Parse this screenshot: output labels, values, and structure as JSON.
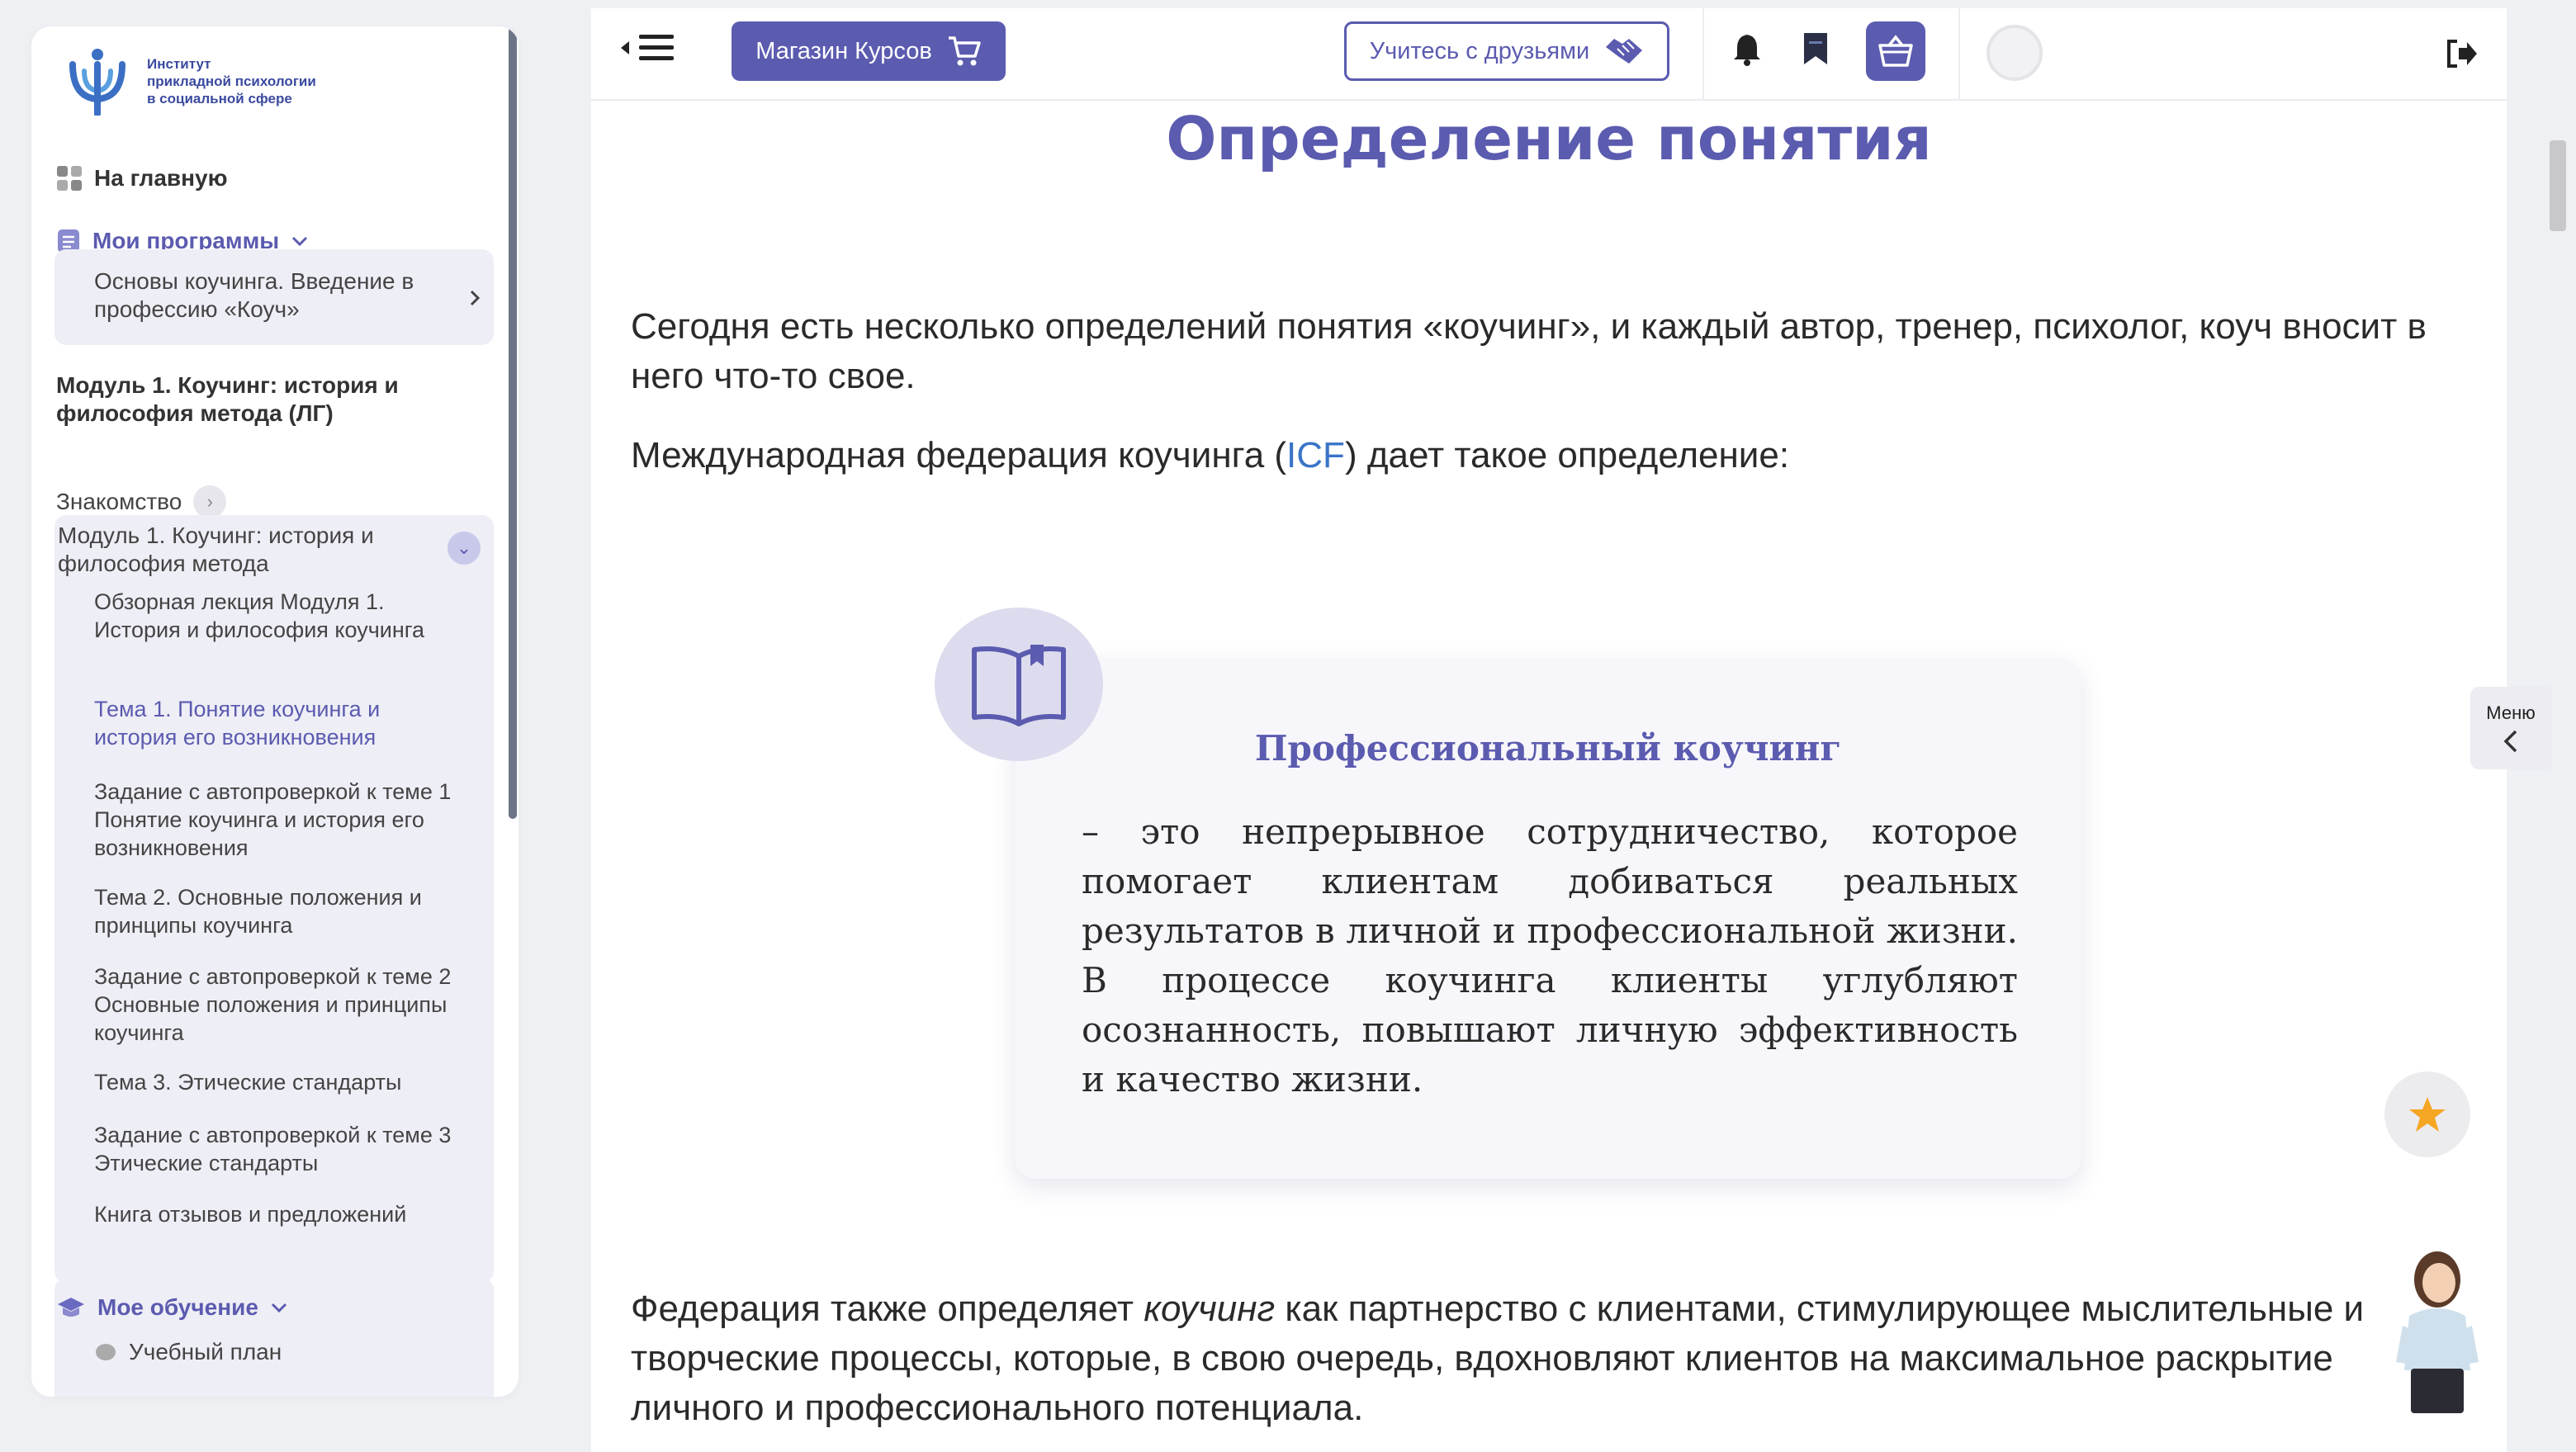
{
  "sidebar": {
    "logo": {
      "line1": "Институт",
      "line2": "прикладной психологии",
      "line3": "в социальной сфере"
    },
    "home_label": "На главную",
    "my_programs_label": "Мои программы",
    "program_title": "Основы коучинга. Введение в профессию «Коуч»",
    "module_heading": "Модуль 1. Коучинг: история и философия метода (ЛГ)",
    "intro_label": "Знакомство",
    "module_group_label": "Модуль 1. Коучинг: история и философия метода",
    "items": [
      {
        "label": "Обзорная лекция Модуля 1. История и философия коучинга",
        "active": false
      },
      {
        "label": "Тема 1. Понятие коучинга и история его возникновения",
        "active": true
      },
      {
        "label": "Задание с автопроверкой к теме 1 Понятие коучинга и история его возникновения",
        "active": false
      },
      {
        "label": "Тема 2. Основные положения и принципы коучинга",
        "active": false
      },
      {
        "label": "Задание с автопроверкой к теме 2 Основные положения и принципы коучинга",
        "active": false
      },
      {
        "label": "Тема 3. Этические стандарты",
        "active": false
      },
      {
        "label": "Задание с автопроверкой к теме 3 Этические стандарты",
        "active": false
      },
      {
        "label": "Книга отзывов и предложений",
        "active": false
      }
    ],
    "my_learning_label": "Мое обучение",
    "study_plan_label": "Учебный план"
  },
  "header": {
    "shop_label": "Магазин Курсов",
    "friends_label": "Учитесь с друзьями"
  },
  "main": {
    "title": "Определение понятия",
    "para1": "Сегодня есть несколько определений понятия «коучинг», и каждый автор, тренер, психолог, коуч вносит в него что-то свое.",
    "para2_before": "Международная федерация коучинга (",
    "para2_link": "ICF",
    "para2_after": ") дает такое определение:",
    "quote_title": "Профессиональный коучинг",
    "quote_text": " – это непрерывное сотрудничество, которое помогает клиентам добиваться реальных результатов в личной и профессиональной жизни. В процессе коучинга клиенты углубляют осознанность, повышают личную эффективность и качество жизни.",
    "para3_before": "Федерация также определяет ",
    "para3_em": "коучинг",
    "para3_after": " как партнерство с клиентами, стимулирующее мыслительные и творческие процессы, которые, в свою очередь, вдохновляют клиентов на максимальное раскрытие личного и профессионального потенциала."
  },
  "right": {
    "menu_label": "Меню"
  },
  "colors": {
    "accent": "#5b5bb0",
    "link": "#3a74c8",
    "star": "#f5a623"
  }
}
